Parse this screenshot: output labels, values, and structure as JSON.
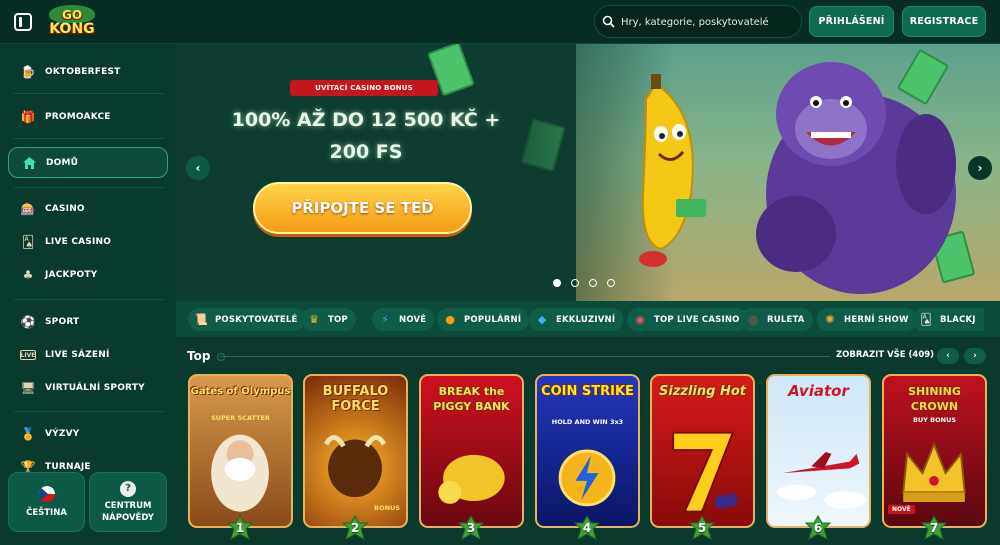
{
  "header": {
    "logo_text": [
      "GO",
      "KONG"
    ],
    "search_placeholder": "Hry, kategorie, poskytovatelé",
    "login_label": "PŘIHLÁŠENÍ",
    "register_label": "REGISTRACE"
  },
  "sidebar": {
    "items": [
      {
        "label": "OKTOBERFEST",
        "icon": "beer-mug-icon"
      },
      {
        "label": "PROMOAKCE",
        "icon": "gift-icon"
      },
      {
        "label": "DOMŮ",
        "icon": "home-icon",
        "active": true
      },
      {
        "label": "CASINO",
        "icon": "slot-machine-icon"
      },
      {
        "label": "LIVE CASINO",
        "icon": "cards-icon"
      },
      {
        "label": "JACKPOTY",
        "icon": "clover-icon"
      },
      {
        "label": "SPORT",
        "icon": "ball-icon"
      },
      {
        "label": "LIVE SÁZENÍ",
        "icon": "live-icon"
      },
      {
        "label": "VIRTUÁLNÍ SPORTY",
        "icon": "monitor-icon"
      },
      {
        "label": "VÝZVY",
        "icon": "medal-icon"
      },
      {
        "label": "TURNAJE",
        "icon": "trophy-icon"
      }
    ],
    "language_label": "ČEŠTINA",
    "help_label": "CENTRUM NÁPOVĚDY"
  },
  "hero": {
    "badge": "UVÍTACÍ CASINO BONUS",
    "title_line1": "100% AŽ DO 12 500 KČ +",
    "title_line2": "200 FS",
    "cta_label": "PŘIPOJTE SE TEĎ",
    "slides_total": 4,
    "slide_active": 1
  },
  "chips": [
    {
      "label": "POSKYTOVATELÉ",
      "icon": "scroll-icon",
      "color": "#d8b36a"
    },
    {
      "label": "TOP",
      "icon": "crown-icon",
      "color": "#f3c22c"
    },
    {
      "label": "NOVÉ",
      "icon": "lightning-icon",
      "color": "#3aa3f5"
    },
    {
      "label": "POPULÁRNÍ",
      "icon": "fire-icon",
      "color": "#f29a1a"
    },
    {
      "label": "EKKLUZIVNÍ",
      "icon": "diamond-icon",
      "color": "#38b6f0"
    },
    {
      "label": "TOP LIVE CASINO",
      "icon": "chip-icon",
      "color": "#e45a5a"
    },
    {
      "label": "RULETA",
      "icon": "roulette-icon",
      "color": "#e05a3a"
    },
    {
      "label": "HERNÍ SHOW",
      "icon": "wheel-icon",
      "color": "#e8a93a"
    },
    {
      "label": "BLACKJ",
      "icon": "cards-icon",
      "color": "#e8e8e8"
    }
  ],
  "top_section": {
    "title": "Top",
    "show_all": "ZOBRAZIT VŠE (409)",
    "games": [
      {
        "rank": "1",
        "title": "Gates of Olympus",
        "subtitle": "SUPER SCATTER",
        "bg": "#c98a3a"
      },
      {
        "rank": "2",
        "title": "BUFFALO FORCE",
        "subtitle": "BONUS",
        "bg": "#8a3a10"
      },
      {
        "rank": "3",
        "title": "BREAK the PIGGY BANK",
        "subtitle": "",
        "bg": "#b0101a"
      },
      {
        "rank": "4",
        "title": "COIN STRIKE",
        "subtitle": "HOLD AND WIN 3x3",
        "bg": "#1b2f9a"
      },
      {
        "rank": "5",
        "title": "Sizzling Hot",
        "subtitle": "",
        "bg": "#c4141a"
      },
      {
        "rank": "6",
        "title": "Aviator",
        "subtitle": "",
        "bg": "#d8ecf8"
      },
      {
        "rank": "7",
        "title": "SHINING CROWN",
        "subtitle": "BUY BONUS",
        "bg": "#b80f1d",
        "badge": "NOVÉ"
      }
    ]
  }
}
